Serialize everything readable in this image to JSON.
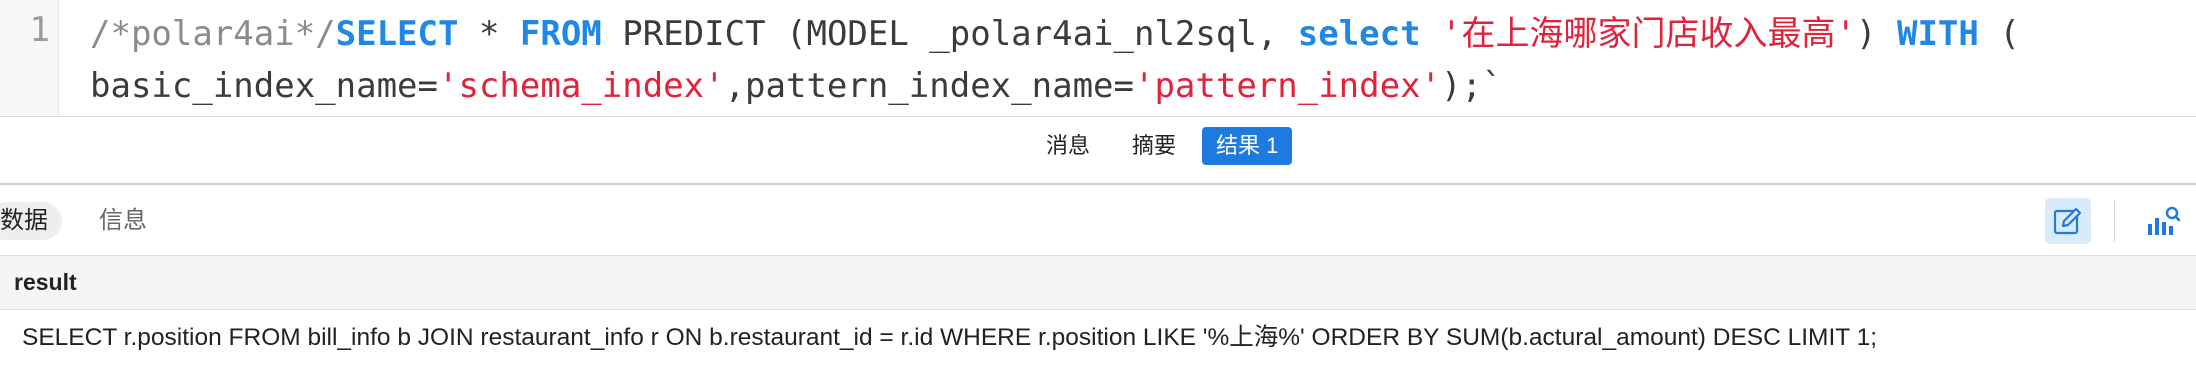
{
  "editor": {
    "line_number": "1",
    "line1": {
      "comment": "/*polar4ai*/",
      "kw_select": "SELECT",
      "star": " * ",
      "kw_from": "FROM",
      "predict": " PREDICT (MODEL _polar4ai_nl2sql, ",
      "kw_select_lower": "select",
      "space1": " ",
      "question": "'在上海哪家门店收入最高'",
      "close": ") ",
      "kw_with": "WITH",
      "open": " ("
    },
    "line2": {
      "basic_key": "basic_index_name=",
      "basic_value": "'schema_index'",
      "pattern_key": ",pattern_index_name=",
      "pattern_value": "'pattern_index'",
      "tail": ");`"
    }
  },
  "result_tabs": {
    "messages": "消息",
    "summary": "摘要",
    "result1": "结果 1"
  },
  "sub_toolbar": {
    "data_tab": "数据",
    "info_tab": "信息"
  },
  "grid": {
    "columns": [
      "result"
    ],
    "rows": [
      [
        "SELECT r.position FROM bill_info b JOIN restaurant_info r ON b.restaurant_id = r.id WHERE r.position LIKE '%上海%' ORDER BY SUM(b.actural_amount) DESC LIMIT 1;"
      ]
    ]
  },
  "colors": {
    "accent": "#1f7ae0",
    "keyword": "#1f87e6",
    "string": "#e0233a",
    "comment": "#8b8b8b"
  },
  "icons": {
    "edit": "edit-pencil-icon",
    "chart": "chart-search-icon"
  }
}
